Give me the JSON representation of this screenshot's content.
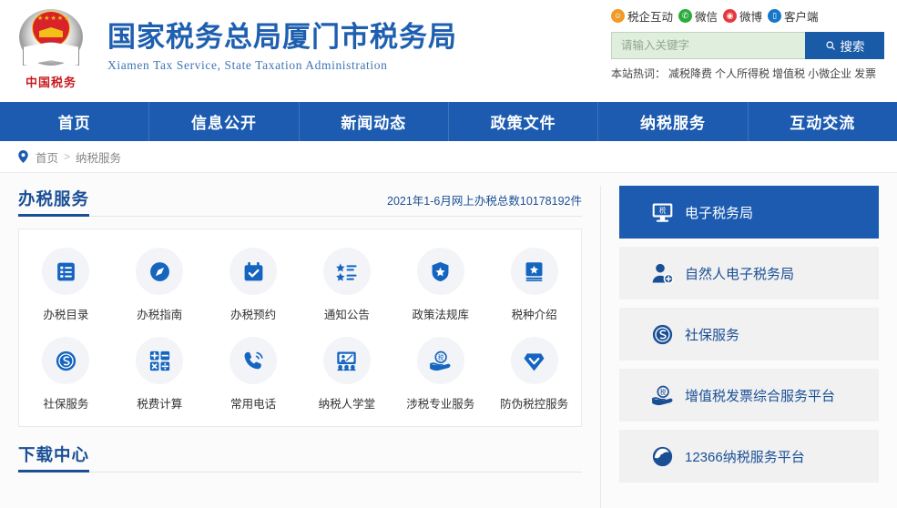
{
  "header": {
    "logo_text": "中国税务",
    "title_cn": "国家税务总局厦门市税务局",
    "title_en": "Xiamen Tax Service, State Taxation Administration",
    "socials": [
      {
        "label": "税企互动",
        "icon": "chat-icon",
        "color": "#f09a27"
      },
      {
        "label": "微信",
        "icon": "wechat-icon",
        "color": "#2bab3c"
      },
      {
        "label": "微博",
        "icon": "weibo-icon",
        "color": "#e4393c"
      },
      {
        "label": "客户端",
        "icon": "app-icon",
        "color": "#1677c9"
      }
    ],
    "search": {
      "placeholder": "请输入关键字",
      "value": "",
      "button_label": "搜索",
      "button_icon": "search-icon"
    },
    "hotwords": {
      "label": "本站热词：",
      "items": [
        "减税降费",
        "个人所得税",
        "增值税",
        "小微企业",
        "发票"
      ]
    }
  },
  "nav": {
    "items": [
      {
        "label": "首页"
      },
      {
        "label": "信息公开"
      },
      {
        "label": "新闻动态"
      },
      {
        "label": "政策文件"
      },
      {
        "label": "纳税服务"
      },
      {
        "label": "互动交流"
      }
    ]
  },
  "breadcrumb": {
    "icon": "location-pin-icon",
    "home": "首页",
    "separator": ">",
    "current": "纳税服务"
  },
  "main": {
    "section_title": "办税服务",
    "section_stat": "2021年1-6月网上办税总数10178192件",
    "tiles": [
      {
        "label": "办税目录",
        "icon": "list-doc-icon"
      },
      {
        "label": "办税指南",
        "icon": "compass-icon"
      },
      {
        "label": "办税预约",
        "icon": "calendar-check-icon"
      },
      {
        "label": "通知公告",
        "icon": "star-list-icon"
      },
      {
        "label": "政策法规库",
        "icon": "shield-star-icon"
      },
      {
        "label": "税种介绍",
        "icon": "book-star-icon"
      },
      {
        "label": "社保服务",
        "icon": "social-security-icon"
      },
      {
        "label": "税费计算",
        "icon": "calculator-icon"
      },
      {
        "label": "常用电话",
        "icon": "phone-icon"
      },
      {
        "label": "纳税人学堂",
        "icon": "classroom-icon"
      },
      {
        "label": "涉税专业服务",
        "icon": "hand-tax-icon"
      },
      {
        "label": "防伪税控服务",
        "icon": "diamond-shield-icon"
      }
    ],
    "download_title": "下载中心"
  },
  "sidebar": {
    "items": [
      {
        "label": "电子税务局",
        "icon": "monitor-tax-icon",
        "active": true
      },
      {
        "label": "自然人电子税务局",
        "icon": "person-add-icon",
        "active": false
      },
      {
        "label": "社保服务",
        "icon": "social-security-icon",
        "active": false
      },
      {
        "label": "增值税发票综合服务平台",
        "icon": "hand-tax-icon",
        "active": false
      },
      {
        "label": "12366纳税服务平台",
        "icon": "pinwheel-icon",
        "active": false
      }
    ]
  },
  "colors": {
    "brand_blue": "#1c5bb0",
    "title_blue": "#1a4f96",
    "nav_blue": "#1c5bb0",
    "icon_blue": "#1565c0",
    "panel_gray": "#f1f1f1",
    "tile_circle": "#f2f4f8",
    "search_green": "#dfeedd"
  }
}
